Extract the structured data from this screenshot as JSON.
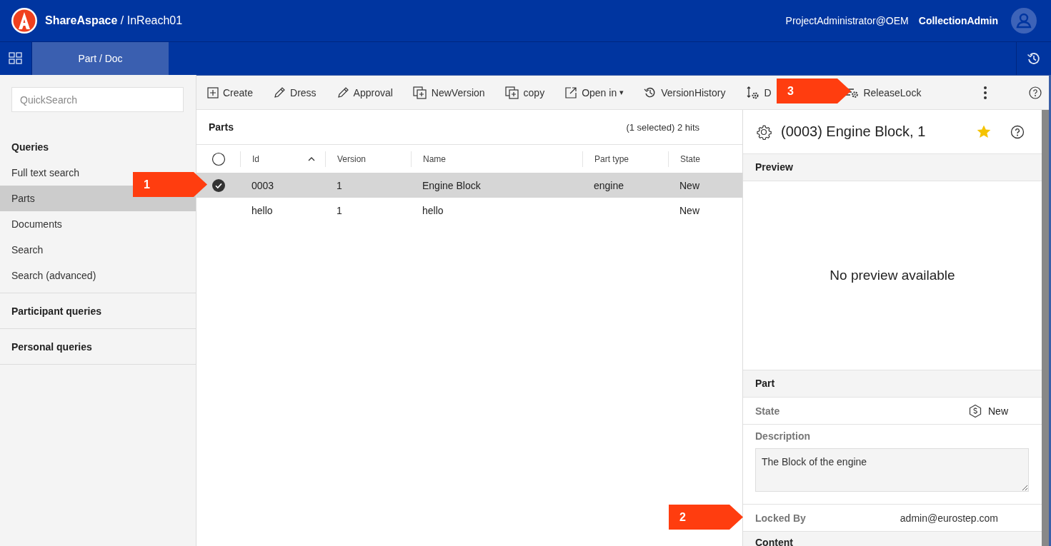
{
  "header": {
    "brand": "ShareAspace",
    "separator": " / ",
    "collection": "InReach01",
    "user": "ProjectAdministrator@OEM",
    "role": "CollectionAdmin"
  },
  "tabs": [
    {
      "label": "Part / Doc",
      "selected": true
    }
  ],
  "sidebar": {
    "search_placeholder": "QuickSearch",
    "sections": [
      {
        "title": "Queries",
        "items": [
          {
            "label": "Full text search",
            "selected": false
          },
          {
            "label": "Parts",
            "selected": true
          },
          {
            "label": "Documents",
            "selected": false
          },
          {
            "label": "Search",
            "selected": false
          },
          {
            "label": "Search (advanced)",
            "selected": false
          }
        ]
      },
      {
        "title": "Participant queries"
      },
      {
        "title": "Personal queries"
      }
    ]
  },
  "toolbar": [
    {
      "kind": "create",
      "label": "Create"
    },
    {
      "kind": "edit",
      "label": "Dress"
    },
    {
      "kind": "edit",
      "label": "Approval"
    },
    {
      "kind": "stack",
      "label": "NewVersion"
    },
    {
      "kind": "stack",
      "label": "copy"
    },
    {
      "kind": "external",
      "label": "Open in",
      "caret": "▾"
    },
    {
      "kind": "history",
      "label": "VersionHistory"
    },
    {
      "kind": "sort-gear",
      "label": "D"
    },
    {
      "kind": "list-gear",
      "label": "ReleaseLock"
    }
  ],
  "parts": {
    "title": "Parts",
    "hits": "(1 selected) 2 hits",
    "all_selected": false,
    "columns": [
      {
        "label": "Id",
        "sorted": true
      },
      {
        "label": "Version",
        "sorted": false
      },
      {
        "label": "Name",
        "sorted": false
      },
      {
        "label": "Part type",
        "sorted": false
      },
      {
        "label": "State",
        "sorted": false
      }
    ],
    "rows": [
      {
        "selected": true,
        "cells": [
          "0003",
          "1",
          "Engine Block",
          "engine",
          "New"
        ]
      },
      {
        "selected": false,
        "cells": [
          "hello",
          "1",
          "hello",
          "",
          "New"
        ]
      }
    ]
  },
  "detail": {
    "title": "(0003) Engine Block, 1",
    "favorite": true,
    "sections": [
      {
        "kind": "preview",
        "title": "Preview",
        "message": "No preview available"
      },
      {
        "kind": "fields",
        "title": "Part",
        "fields": [
          {
            "kind": "state",
            "label": "State",
            "value": "New"
          },
          {
            "kind": "textarea",
            "label": "Description",
            "value": "The Block of the engine"
          },
          {
            "kind": "text",
            "label": "Locked By",
            "value": "admin@eurostep.com"
          }
        ]
      },
      {
        "kind": "heading",
        "title": "Content"
      }
    ]
  },
  "callouts": [
    {
      "label": "1"
    },
    {
      "label": "2"
    },
    {
      "label": "3"
    }
  ]
}
